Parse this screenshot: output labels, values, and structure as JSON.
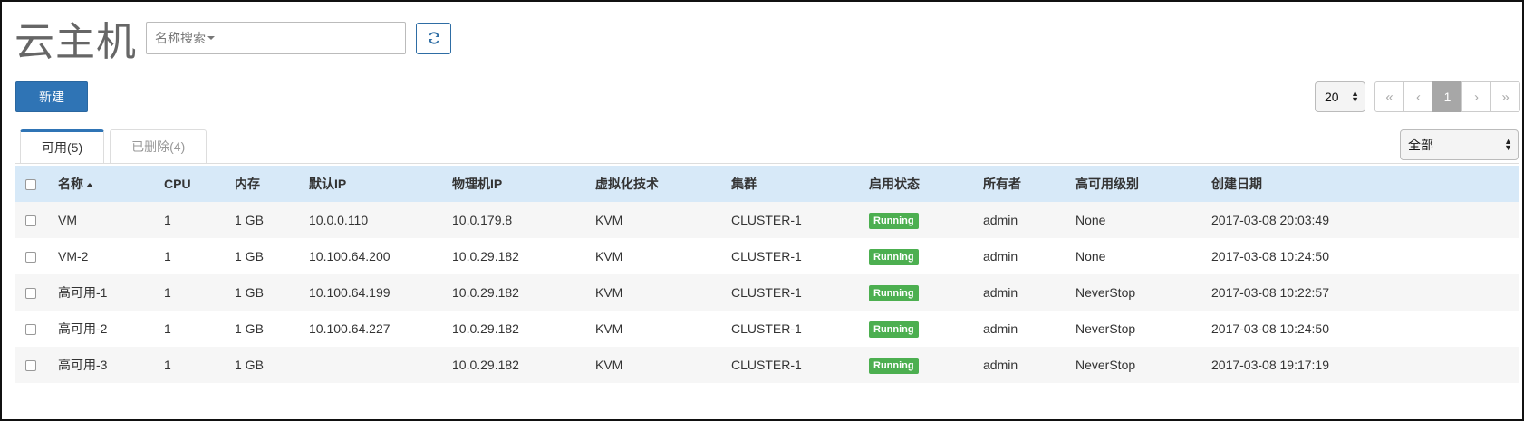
{
  "page": {
    "title": "云主机",
    "search_placeholder": "名称搜索"
  },
  "toolbar": {
    "new_label": "新建",
    "page_size": "20",
    "pager": [
      "«",
      "‹",
      "1",
      "›",
      "»"
    ],
    "filter_value": "全部"
  },
  "tabs": [
    {
      "label": "可用(5)",
      "active": true
    },
    {
      "label": "已删除(4)",
      "active": false
    }
  ],
  "table": {
    "columns": [
      "名称",
      "CPU",
      "内存",
      "默认IP",
      "物理机IP",
      "虚拟化技术",
      "集群",
      "启用状态",
      "所有者",
      "高可用级别",
      "创建日期"
    ],
    "sort_column": "名称",
    "rows": [
      {
        "name": "VM",
        "cpu": "1",
        "memory": "1 GB",
        "default_ip": "10.0.0.110",
        "host_ip": "10.0.179.8",
        "hypervisor": "KVM",
        "cluster": "CLUSTER-1",
        "status": "Running",
        "owner": "admin",
        "ha_level": "None",
        "created": "2017-03-08 20:03:49"
      },
      {
        "name": "VM-2",
        "cpu": "1",
        "memory": "1 GB",
        "default_ip": "10.100.64.200",
        "host_ip": "10.0.29.182",
        "hypervisor": "KVM",
        "cluster": "CLUSTER-1",
        "status": "Running",
        "owner": "admin",
        "ha_level": "None",
        "created": "2017-03-08 10:24:50"
      },
      {
        "name": "高可用-1",
        "cpu": "1",
        "memory": "1 GB",
        "default_ip": "10.100.64.199",
        "host_ip": "10.0.29.182",
        "hypervisor": "KVM",
        "cluster": "CLUSTER-1",
        "status": "Running",
        "owner": "admin",
        "ha_level": "NeverStop",
        "created": "2017-03-08 10:22:57"
      },
      {
        "name": "高可用-2",
        "cpu": "1",
        "memory": "1 GB",
        "default_ip": "10.100.64.227",
        "host_ip": "10.0.29.182",
        "hypervisor": "KVM",
        "cluster": "CLUSTER-1",
        "status": "Running",
        "owner": "admin",
        "ha_level": "NeverStop",
        "created": "2017-03-08 10:24:50"
      },
      {
        "name": "高可用-3",
        "cpu": "1",
        "memory": "1 GB",
        "default_ip": "",
        "host_ip": "10.0.29.182",
        "hypervisor": "KVM",
        "cluster": "CLUSTER-1",
        "status": "Running",
        "owner": "admin",
        "ha_level": "NeverStop",
        "created": "2017-03-08 19:17:19"
      }
    ]
  },
  "colors": {
    "primary": "#2f74b5",
    "header_row": "#d7e9f8",
    "running_badge": "#4caf50",
    "pager_active": "#a7a7a7"
  },
  "icons": {
    "refresh": "refresh-icon",
    "search_dropdown": "chevron-down-icon",
    "sort": "sort-ascending-icon",
    "select_arrows": "up-down-arrows-icon"
  }
}
